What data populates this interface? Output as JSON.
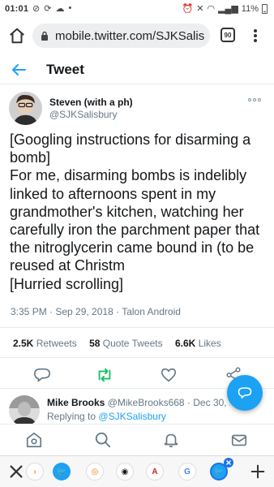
{
  "status_bar": {
    "time": "01:01",
    "battery": "11%"
  },
  "browser": {
    "url": "mobile.twitter.com/SJKSalis",
    "tab_count": "90"
  },
  "header": {
    "title": "Tweet"
  },
  "tweet": {
    "author_name": "Steven (with a ph)",
    "author_handle": "@SJKSalisbury",
    "lines": [
      "[Googling instructions for disarming a",
      "bomb]",
      "For me, disarming bombs is indelibly",
      "linked to afternoons spent in my",
      "grandmother's kitchen, watching her",
      "carefully iron the parchment paper that",
      "the nitroglycerin came bound in (to be",
      "reused at Christm",
      "[Hurried scrolling]"
    ],
    "meta": "3:35 PM · Sep 29, 2018 · Talon Android",
    "retweets_count": "2.5K",
    "retweets_label": "Retweets",
    "quotes_count": "58",
    "quotes_label": "Quote Tweets",
    "likes_count": "6.6K",
    "likes_label": "Likes"
  },
  "reply": {
    "name": "Mike Brooks",
    "handle": "@MikeBrooks668",
    "date": "· Dec 30, 20",
    "replying_to_label": "Replying to",
    "replying_to_handle": "@SJKSalisbury"
  },
  "colors": {
    "accent": "#1da1f2",
    "retweet_green": "#17bf63"
  }
}
